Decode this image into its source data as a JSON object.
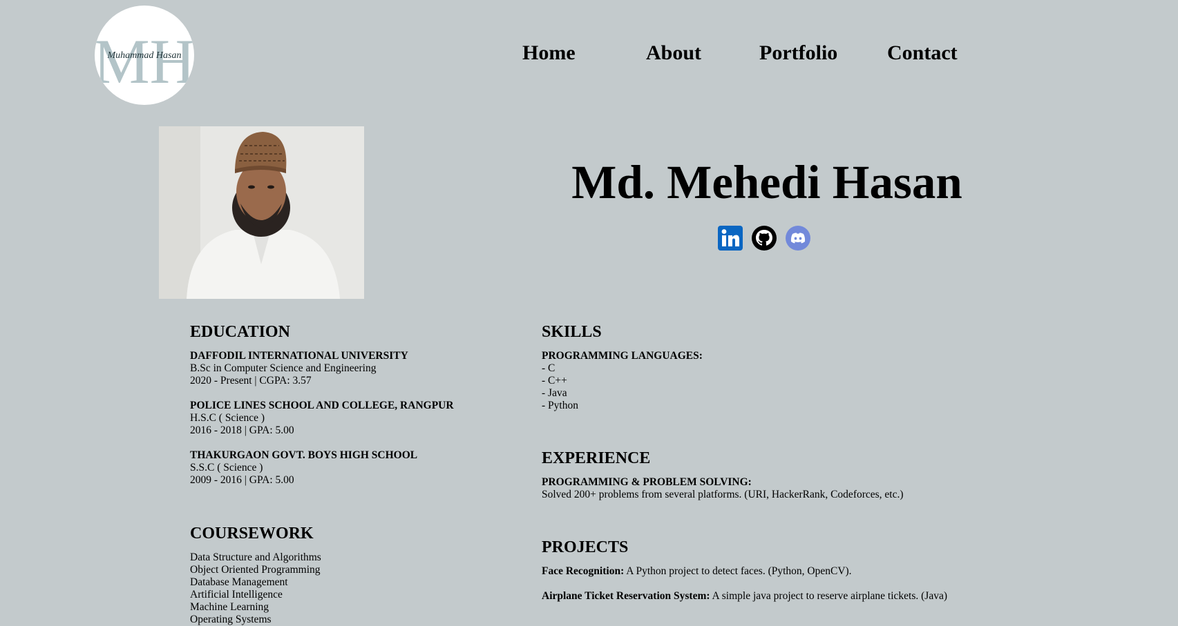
{
  "logo": {
    "monogram": "MH",
    "signature": "Muhammad Hasan"
  },
  "nav": {
    "items": [
      "Home",
      "About",
      "Portfolio",
      "Contact"
    ]
  },
  "profile": {
    "name": "Md. Mehedi Hasan",
    "socials": [
      "linkedin-icon",
      "github-icon",
      "discord-icon"
    ]
  },
  "education": {
    "heading": "EDUCATION",
    "entries": [
      {
        "school": "DAFFODIL INTERNATIONAL UNIVERSITY",
        "degree": "B.Sc in Computer Science and Engineering",
        "period": "2020 - Present",
        "score": "CGPA: 3.57"
      },
      {
        "school": "POLICE LINES SCHOOL AND COLLEGE, RANGPUR",
        "degree": "H.S.C ( Science )",
        "period": "2016 - 2018",
        "score": "GPA: 5.00"
      },
      {
        "school": "THAKURGAON GOVT. BOYS HIGH SCHOOL",
        "degree": "S.S.C ( Science )",
        "period": "2009 - 2016",
        "score": "GPA: 5.00"
      }
    ]
  },
  "coursework": {
    "heading": "COURSEWORK",
    "items": [
      "Data Structure and Algorithms",
      "Object Oriented Programming",
      "Database Management",
      "Artificial Intelligence",
      "Machine Learning",
      "Operating Systems"
    ]
  },
  "skills": {
    "heading": "SKILLS",
    "subheading": "PROGRAMMING LANGUAGES:",
    "items": [
      "- C",
      "- C++",
      "- Java",
      "- Python"
    ]
  },
  "experience": {
    "heading": "EXPERIENCE",
    "subheading": "PROGRAMMING & PROBLEM SOLVING:",
    "text": "Solved 200+ problems from several platforms. (URI, HackerRank, Codeforces, etc.)"
  },
  "projects": {
    "heading": "PROJECTS",
    "items": [
      {
        "title": "Face Recognition:",
        "desc": " A Python project to detect faces. (Python, OpenCV)."
      },
      {
        "title": "Airplane Ticket Reservation System:",
        "desc": " A simple java project to reserve airplane tickets. (Java)"
      }
    ]
  },
  "colors": {
    "background": "#c3cacc",
    "linkedin": "#0a66c2",
    "discord": "#7289da"
  }
}
